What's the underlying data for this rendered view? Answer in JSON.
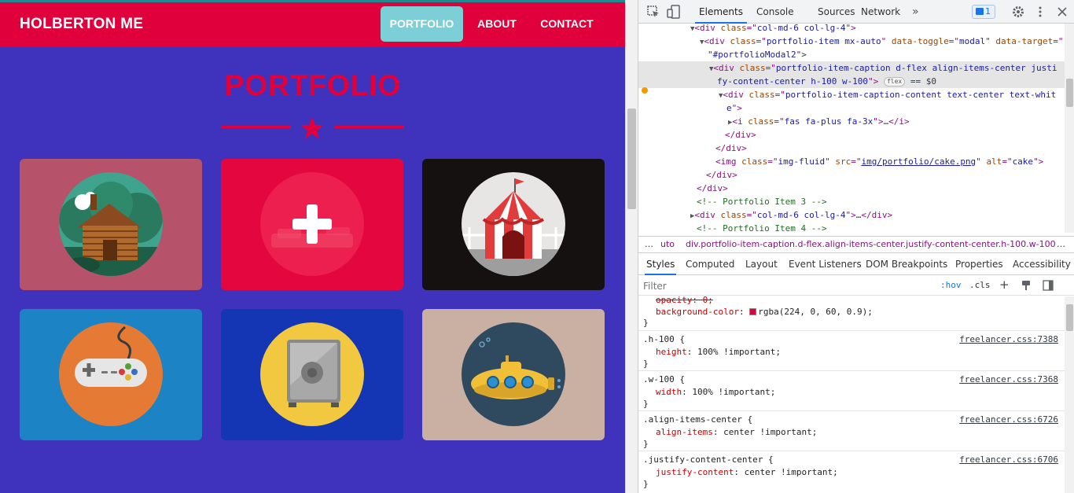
{
  "site": {
    "brand": "HOLBERTON ME",
    "nav": {
      "portfolio": "PORTFOLIO",
      "about": "ABOUT",
      "contact": "CONTACT"
    },
    "section_title": "PORTFOLIO",
    "colors": {
      "navbar": "#e0003c",
      "background": "#3f33bd",
      "active_nav": "#7ccfd6",
      "accent": "#e0003c"
    },
    "tiles": [
      {
        "icon": "log-cabin-icon",
        "bg": "#b6536b"
      },
      {
        "icon": "cake-icon",
        "bg": "#e4073f",
        "hover_overlay": "plus-icon"
      },
      {
        "icon": "circus-tent-icon",
        "bg": "#151111"
      },
      {
        "icon": "game-controller-icon",
        "bg": "#1c83c4"
      },
      {
        "icon": "safe-icon",
        "bg": "#1436b5"
      },
      {
        "icon": "submarine-icon",
        "bg": "#c9b0a3"
      }
    ]
  },
  "devtools": {
    "tabs": {
      "elements": "Elements",
      "console": "Console",
      "sources": "Sources",
      "network": "Network",
      "more": "»"
    },
    "issues_count": "1",
    "dom": {
      "l1": {
        "tag": "div",
        "class": "col-md-6 col-lg-4"
      },
      "l2": {
        "tag": "div",
        "class": "portfolio-item mx-auto",
        "toggle_attr": "data-toggle",
        "toggle": "modal",
        "target_attr": "data-target",
        "target_a": "",
        "target_b": "#portfolioModal2"
      },
      "l3": {
        "tag": "div",
        "class_a": "portfolio-item-caption d-flex align-items-center justi",
        "class_b": "fy-content-center h-100 w-100",
        "badge": "flex",
        "eq": "== $0"
      },
      "l4": {
        "tag": "div",
        "class_a": "portfolio-item-caption-content text-center text-whit",
        "class_b": "e"
      },
      "l5": {
        "tag": "i",
        "class": "fas fa-plus fa-3x",
        "ellipsis": "…"
      },
      "close_div": "div",
      "img": {
        "tag": "img",
        "class": "img-fluid",
        "src": "img/portfolio/cake.png",
        "alt": "cake"
      },
      "comment3": "<!-- Portfolio Item 3 -->",
      "l_collapsed": {
        "tag": "div",
        "class": "col-md-6 col-lg-4",
        "ellipsis": "…"
      },
      "comment4": "<!-- Portfolio Item 4 -->"
    },
    "breadcrumb": {
      "dots": "…",
      "item1": "uto",
      "item2": "div.portfolio-item-caption.d-flex.align-items-center.justify-content-center.h-100.w-100",
      "more": "…"
    },
    "style_tabs": {
      "styles": "Styles",
      "computed": "Computed",
      "layout": "Layout",
      "events": "Event Listeners",
      "dombp": "DOM Breakpoints",
      "props": "Properties",
      "access": "Accessibility"
    },
    "filter": {
      "placeholder": "Filter",
      "hov": ":hov",
      "cls": ".cls",
      "plus": "+"
    },
    "rules": {
      "r0": {
        "prop1": "opacity",
        "val1": "0;",
        "prop2": "background-color",
        "val2": "rgba(224, 0, 60, 0.9);",
        "swatch": "#e0003c",
        "close": "}"
      },
      "r1": {
        "selector": ".h-100 {",
        "source": "freelancer.css:7388",
        "prop": "height",
        "val": "100% !important;",
        "close": "}"
      },
      "r2": {
        "selector": ".w-100 {",
        "source": "freelancer.css:7368",
        "prop": "width",
        "val": "100% !important;",
        "close": "}"
      },
      "r3": {
        "selector": ".align-items-center {",
        "source": "freelancer.css:6726",
        "prop": "align-items",
        "val": "center !important;",
        "close": "}"
      },
      "r4": {
        "selector": ".justify-content-center {",
        "source": "freelancer.css:6706",
        "prop": "justify-content",
        "val": "center !important;",
        "close": "}"
      }
    }
  }
}
